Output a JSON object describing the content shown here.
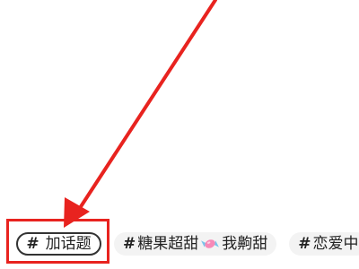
{
  "topic_bar": {
    "add_topic": {
      "hash": "#",
      "label": "加话题"
    },
    "suggestions": [
      {
        "hash": "#",
        "label_before": "糖果超甜",
        "icon": "candy-icon",
        "label_after": "我齁甜"
      },
      {
        "hash": "#",
        "label": "恋爱中"
      }
    ]
  },
  "annotation": {
    "arrow_color": "#e8231f",
    "box_color": "#e8231f"
  }
}
